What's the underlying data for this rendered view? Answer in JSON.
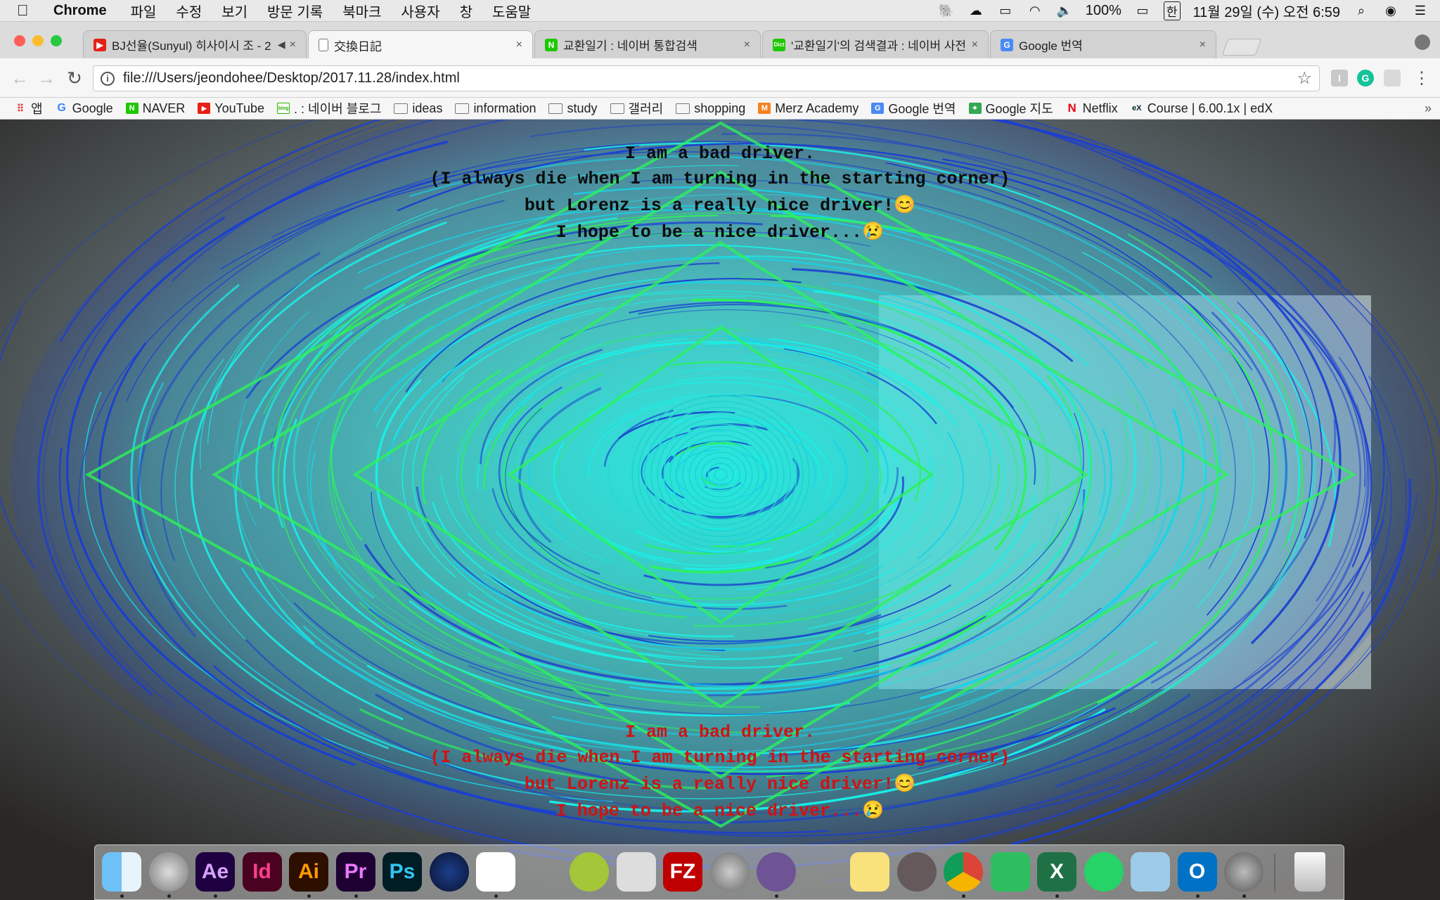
{
  "menubar": {
    "app_name": "Chrome",
    "items": [
      "파일",
      "수정",
      "보기",
      "방문 기록",
      "북마크",
      "사용자",
      "창",
      "도움말"
    ],
    "battery": "100%",
    "input_source": "한",
    "datetime": "11월 29일 (수) 오전 6:59"
  },
  "tabs": [
    {
      "title": "BJ선율(Sunyul) 히사이시 조 - 2",
      "favicon": "youtube-icon",
      "close": "×",
      "speaker": "◀︎"
    },
    {
      "title": "交換日記",
      "favicon": "page-icon",
      "close": "×"
    },
    {
      "title": "교환일기 : 네이버 통합검색",
      "favicon": "naver-icon",
      "close": "×"
    },
    {
      "title": "'교환일기'의 검색결과 : 네이버 사전",
      "favicon": "dict-icon",
      "close": "×"
    },
    {
      "title": "Google 번역",
      "favicon": "google-translate-icon",
      "close": "×"
    }
  ],
  "toolbar": {
    "url": "file:///Users/jeondohee/Desktop/2017.11.28/index.html",
    "info": "i",
    "star": "☆",
    "back": "←",
    "forward": "→",
    "reload": "↻"
  },
  "bookmarks": [
    {
      "label": "앱",
      "icon": "apps-icon"
    },
    {
      "label": "Google",
      "icon": "google-icon"
    },
    {
      "label": "NAVER",
      "icon": "naver-icon"
    },
    {
      "label": "YouTube",
      "icon": "youtube-icon"
    },
    {
      "label": ". : 네이버 블로그",
      "icon": "blog-icon"
    },
    {
      "label": "ideas",
      "icon": "folder-icon"
    },
    {
      "label": "information",
      "icon": "folder-icon"
    },
    {
      "label": "study",
      "icon": "folder-icon"
    },
    {
      "label": "갤러리",
      "icon": "folder-icon"
    },
    {
      "label": "shopping",
      "icon": "folder-icon"
    },
    {
      "label": "Merz Academy",
      "icon": "merz-icon"
    },
    {
      "label": "Google 번역",
      "icon": "google-translate-icon"
    },
    {
      "label": "Google 지도",
      "icon": "google-maps-icon"
    },
    {
      "label": "Netflix",
      "icon": "netflix-icon"
    },
    {
      "label": "Course | 6.00.1x | edX",
      "icon": "edx-icon"
    }
  ],
  "poem": {
    "line1": "I am a bad driver.",
    "line2": "(I always die when I am turning in the starting corner)",
    "line3": "but Lorenz is a really nice driver!😊",
    "line4": "I hope to be a nice driver...😢"
  },
  "colors": {
    "poem_top": "#0c0c0c",
    "poem_bottom": "#d11212",
    "cyan": "#19f0e6",
    "green": "#2cf25a",
    "blue": "#1a3fd0"
  },
  "dock": [
    {
      "name": "finder-icon",
      "label": ""
    },
    {
      "name": "launchpad-icon",
      "label": ""
    },
    {
      "name": "after-effects-icon",
      "label": "Ae"
    },
    {
      "name": "indesign-icon",
      "label": "Id"
    },
    {
      "name": "illustrator-icon",
      "label": "Ai"
    },
    {
      "name": "premiere-icon",
      "label": "Pr"
    },
    {
      "name": "photoshop-icon",
      "label": "Ps"
    },
    {
      "name": "cinema4d-icon",
      "label": ""
    },
    {
      "name": "unity-icon",
      "label": ""
    },
    {
      "name": "pineapple-icon",
      "label": ""
    },
    {
      "name": "android-studio-icon",
      "label": ""
    },
    {
      "name": "python-icon",
      "label": ""
    },
    {
      "name": "filezilla-icon",
      "label": "FZ"
    },
    {
      "name": "sequel-pro-icon",
      "label": ""
    },
    {
      "name": "github-icon",
      "label": ""
    },
    {
      "name": "cyberduck-icon",
      "label": ""
    },
    {
      "name": "notes-icon",
      "label": ""
    },
    {
      "name": "atom-icon",
      "label": ""
    },
    {
      "name": "chrome-icon",
      "label": ""
    },
    {
      "name": "evernote-icon",
      "label": ""
    },
    {
      "name": "excel-icon",
      "label": "X"
    },
    {
      "name": "whatsapp-icon",
      "label": ""
    },
    {
      "name": "preview-icon",
      "label": ""
    },
    {
      "name": "outlook-icon",
      "label": "O"
    },
    {
      "name": "system-preferences-icon",
      "label": ""
    },
    {
      "name": "trash-icon",
      "label": ""
    }
  ]
}
